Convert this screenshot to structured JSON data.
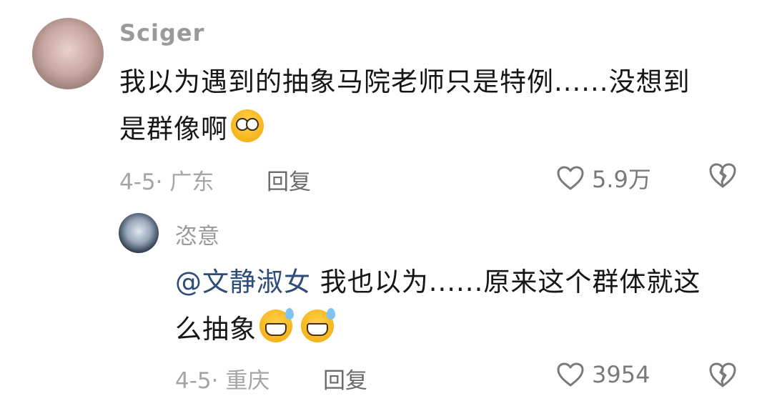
{
  "comment": {
    "username": "Sciger",
    "text_line1": "我以为遇到的抽象马院老师只是特例......没想到",
    "text_line2": "是群像啊",
    "emoji": "flushed-face-emoji",
    "date_location": "4-5· 广东",
    "reply_label": "回复",
    "likes": "5.9万",
    "reply": {
      "username": "恣意",
      "mention": "@文静淑女",
      "text_line1": " 我也以为......原来这个群体就这",
      "text_line2": "么抽象",
      "emojis": [
        "grinning-sweat-emoji",
        "grinning-sweat-emoji"
      ],
      "date_location": "4-5· 重庆",
      "reply_label": "回复",
      "likes": "3954"
    }
  },
  "colors": {
    "text": "#161616",
    "meta": "#a5a5a5",
    "mention": "#2d4c7a"
  }
}
